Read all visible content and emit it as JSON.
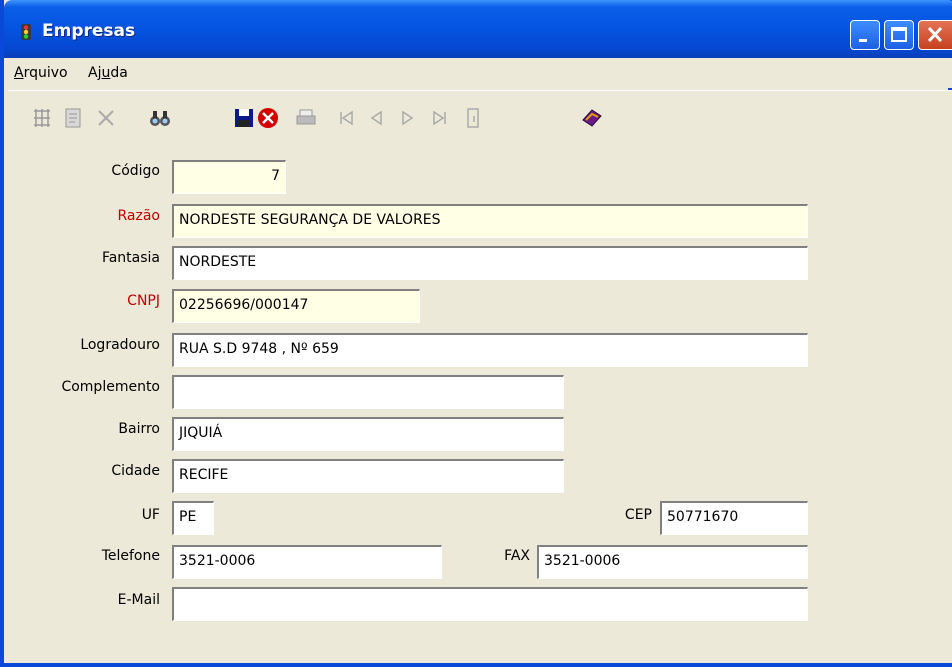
{
  "window": {
    "title": "Empresas"
  },
  "menu": {
    "items": [
      "Arquivo",
      "Ajuda"
    ]
  },
  "toolbar": {
    "icons": [
      "new-record-icon",
      "edit-icon",
      "delete-icon",
      "search-binoculars-icon",
      "save-icon",
      "cancel-icon",
      "print-icon",
      "first-record-icon",
      "previous-record-icon",
      "next-record-icon",
      "last-record-icon",
      "exit-icon",
      "help-book-icon"
    ]
  },
  "form": {
    "codigo": {
      "label": "Código",
      "value": "7"
    },
    "razao": {
      "label": "Razão",
      "value": "NORDESTE SEGURANÇA DE VALORES"
    },
    "fantasia": {
      "label": "Fantasia",
      "value": "NORDESTE"
    },
    "cnpj": {
      "label": "CNPJ",
      "value": "02256696/000147"
    },
    "logradouro": {
      "label": "Logradouro",
      "value": "RUA S.D 9748 , Nº 659"
    },
    "complemento": {
      "label": "Complemento",
      "value": ""
    },
    "bairro": {
      "label": "Bairro",
      "value": "JIQUIÁ"
    },
    "cidade": {
      "label": "Cidade",
      "value": "RECIFE"
    },
    "uf": {
      "label": "UF",
      "value": "PE"
    },
    "cep": {
      "label": "CEP",
      "value": "50771670"
    },
    "telefone": {
      "label": "Telefone",
      "value": "3521-0006"
    },
    "fax": {
      "label": "FAX",
      "value": "3521-0006"
    },
    "email": {
      "label": "E-Mail",
      "value": ""
    }
  },
  "colors": {
    "titlebar": "#0553e1",
    "required_label": "#c00000",
    "field_yellow": "#ffffe6"
  }
}
